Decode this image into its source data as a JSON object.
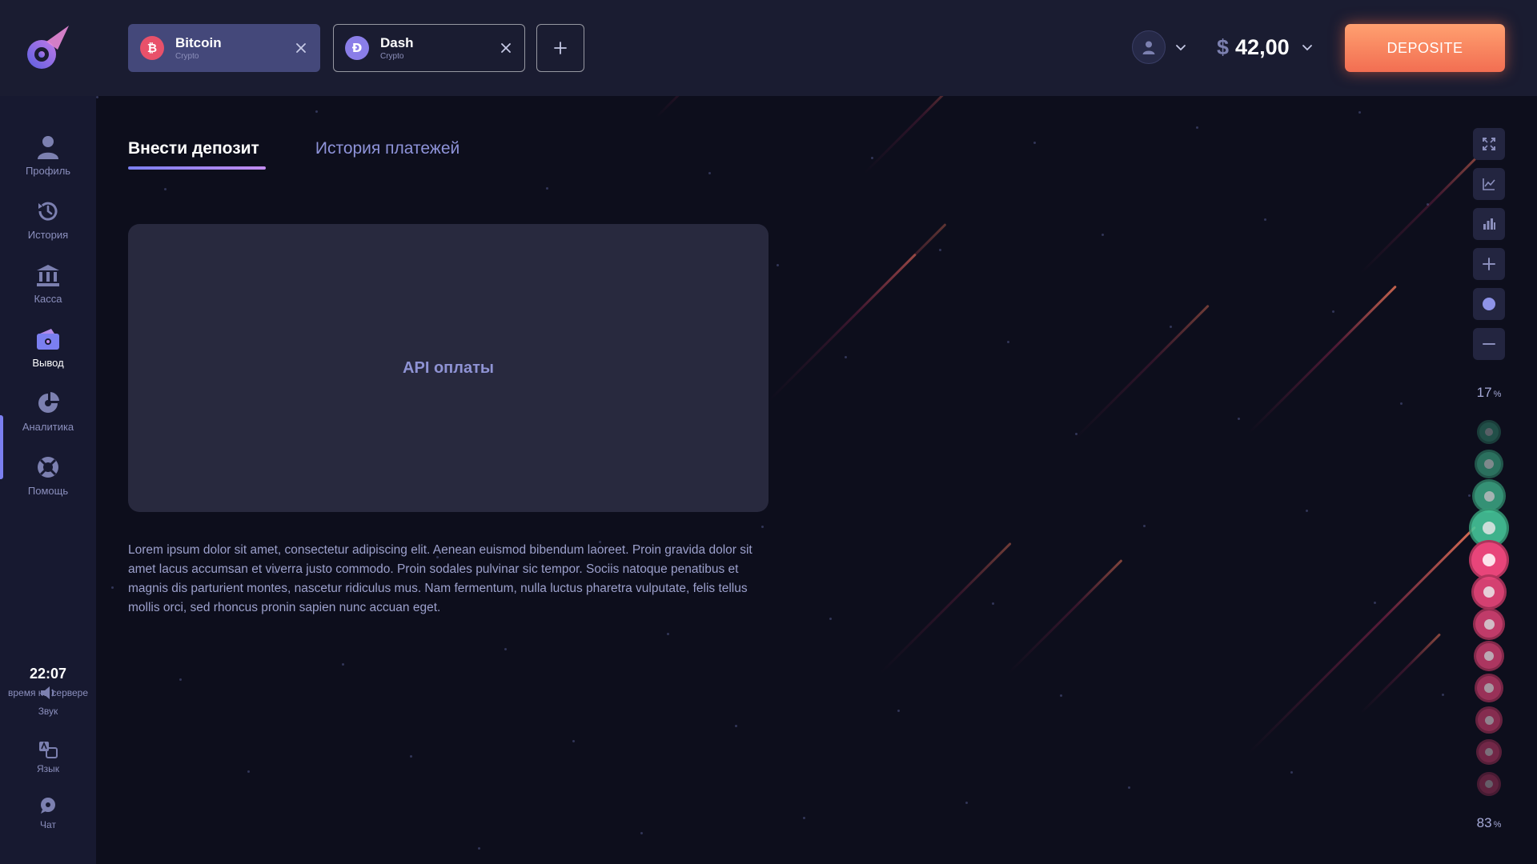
{
  "header": {
    "asset_tabs": [
      {
        "name": "Bitcoin",
        "subtitle": "Crypto",
        "symbol": "₿",
        "active": true
      },
      {
        "name": "Dash",
        "subtitle": "Crypto",
        "symbol": "Ð",
        "active": false
      }
    ],
    "balance": {
      "currency": "$",
      "amount": "42,00"
    },
    "deposit_label": "DEPOSITE"
  },
  "sidebar": {
    "items": [
      {
        "label": "Профиль",
        "icon": "user-icon"
      },
      {
        "label": "История",
        "icon": "history-icon"
      },
      {
        "label": "Касса",
        "icon": "bank-icon"
      },
      {
        "label": "Вывод",
        "icon": "wallet-icon",
        "active": true
      },
      {
        "label": "Аналитика",
        "icon": "analytics-icon"
      },
      {
        "label": "Помощь",
        "icon": "lifebuoy-icon"
      }
    ],
    "server_time": {
      "time": "22:07",
      "label": "время на сервере"
    },
    "utilities": [
      {
        "label": "Звук",
        "icon": "speaker-icon"
      },
      {
        "label": "Язык",
        "icon": "language-icon"
      },
      {
        "label": "Чат",
        "icon": "chat-icon"
      }
    ]
  },
  "main": {
    "tabs": [
      {
        "label": "Внести депозит",
        "active": true
      },
      {
        "label": "История платежей",
        "active": false
      }
    ],
    "api_box_label": "API оплаты",
    "description": "Lorem ipsum dolor sit amet, consectetur adipiscing elit. Aenean euismod bibendum laoreet. Proin gravida dolor sit amet lacus accumsan et viverra justo commodo. Proin sodales pulvinar sic tempor. Sociis natoque penatibus et magnis dis parturient montes, nascetur ridiculus mus. Nam fermentum, nulla luctus pharetra vulputate, felis tellus mollis orci, sed rhoncus pronin sapien nunc accuan eget."
  },
  "right_panel": {
    "tools": [
      "fullscreen-icon",
      "line-chart-icon",
      "bar-chart-icon",
      "plus-icon",
      "circle-icon",
      "minus-icon"
    ],
    "top_percent": "17",
    "bottom_percent": "83",
    "percent_sign": "%",
    "sentiment_dots": [
      "green",
      "green",
      "green",
      "green",
      "red",
      "red",
      "red",
      "red",
      "red",
      "red",
      "red",
      "red"
    ]
  },
  "colors": {
    "accent": "#7b7ff0",
    "deposit_gradient_start": "#ffa070",
    "deposit_gradient_end": "#f26e52",
    "bullish": "#46c79a",
    "bearish": "#e8457a"
  }
}
